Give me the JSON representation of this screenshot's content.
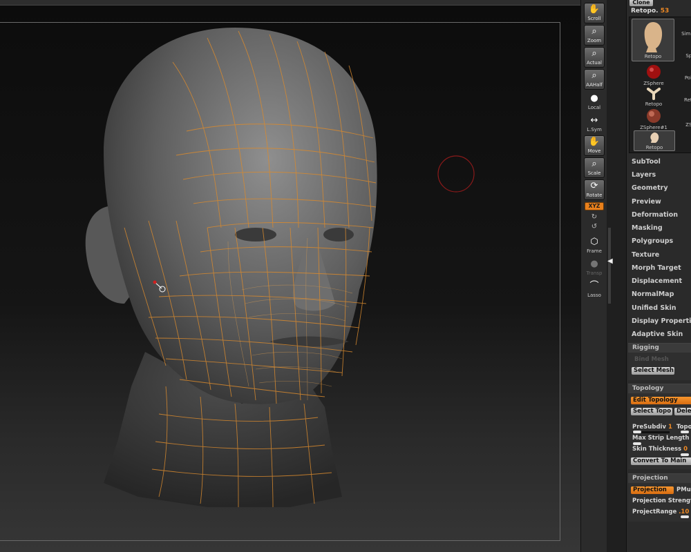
{
  "palette": {
    "clone_label": "Clone",
    "tool_title": "Retopo.",
    "tool_count": "53",
    "thumbnails": [
      {
        "label": "Retopo"
      },
      {
        "label": "Simp"
      },
      {
        "label": "ZSphere"
      },
      {
        "label": "Sph"
      },
      {
        "label": "Poly"
      },
      {
        "label": "Retopo"
      },
      {
        "label": "Reto"
      },
      {
        "label": "ZSphere#1"
      },
      {
        "label": "ZSp"
      },
      {
        "label": "Retopo"
      }
    ],
    "menu": [
      "SubTool",
      "Layers",
      "Geometry",
      "Preview",
      "Deformation",
      "Masking",
      "Polygroups",
      "Texture",
      "Morph Target",
      "Displacement",
      "NormalMap",
      "Unified Skin",
      "Display Properties",
      "Adaptive Skin"
    ],
    "rigging": {
      "title": "Rigging",
      "bind_mesh": "Bind Mesh",
      "select_mesh": "Select Mesh"
    },
    "topology": {
      "title": "Topology",
      "edit_topology": "Edit Topology",
      "select_topo": "Select Topo",
      "delete": "Delet",
      "presubdiv_label": "PreSubdiv",
      "presubdiv_value": "1",
      "topo_label": "Topo",
      "max_strip_label": "Max Strip Length",
      "skin_thickness_label": "Skin Thickness",
      "skin_thickness_value": "0",
      "convert_to_main": "Convert To Main"
    },
    "projection": {
      "title": "Projection",
      "projection_btn": "Projection",
      "pmult": "PMult",
      "projection_strength_label": "Projection Strengt",
      "project_range_label": "ProjectRange",
      "project_range_value": ".10"
    }
  },
  "shelf": {
    "scroll": "Scroll",
    "zoom": "Zoom",
    "actual": "Actual",
    "aahalf": "AAHalf",
    "local": "Local",
    "lsym": "L.Sym",
    "move": "Move",
    "scale": "Scale",
    "rotate": "Rotate",
    "xyz": "XYZ",
    "frame": "Frame",
    "transp": "Transp",
    "lasso": "Lasso"
  },
  "colors": {
    "accent": "#f08a24",
    "wire": "#d98a2e",
    "cursor": "#8b1a1a"
  }
}
